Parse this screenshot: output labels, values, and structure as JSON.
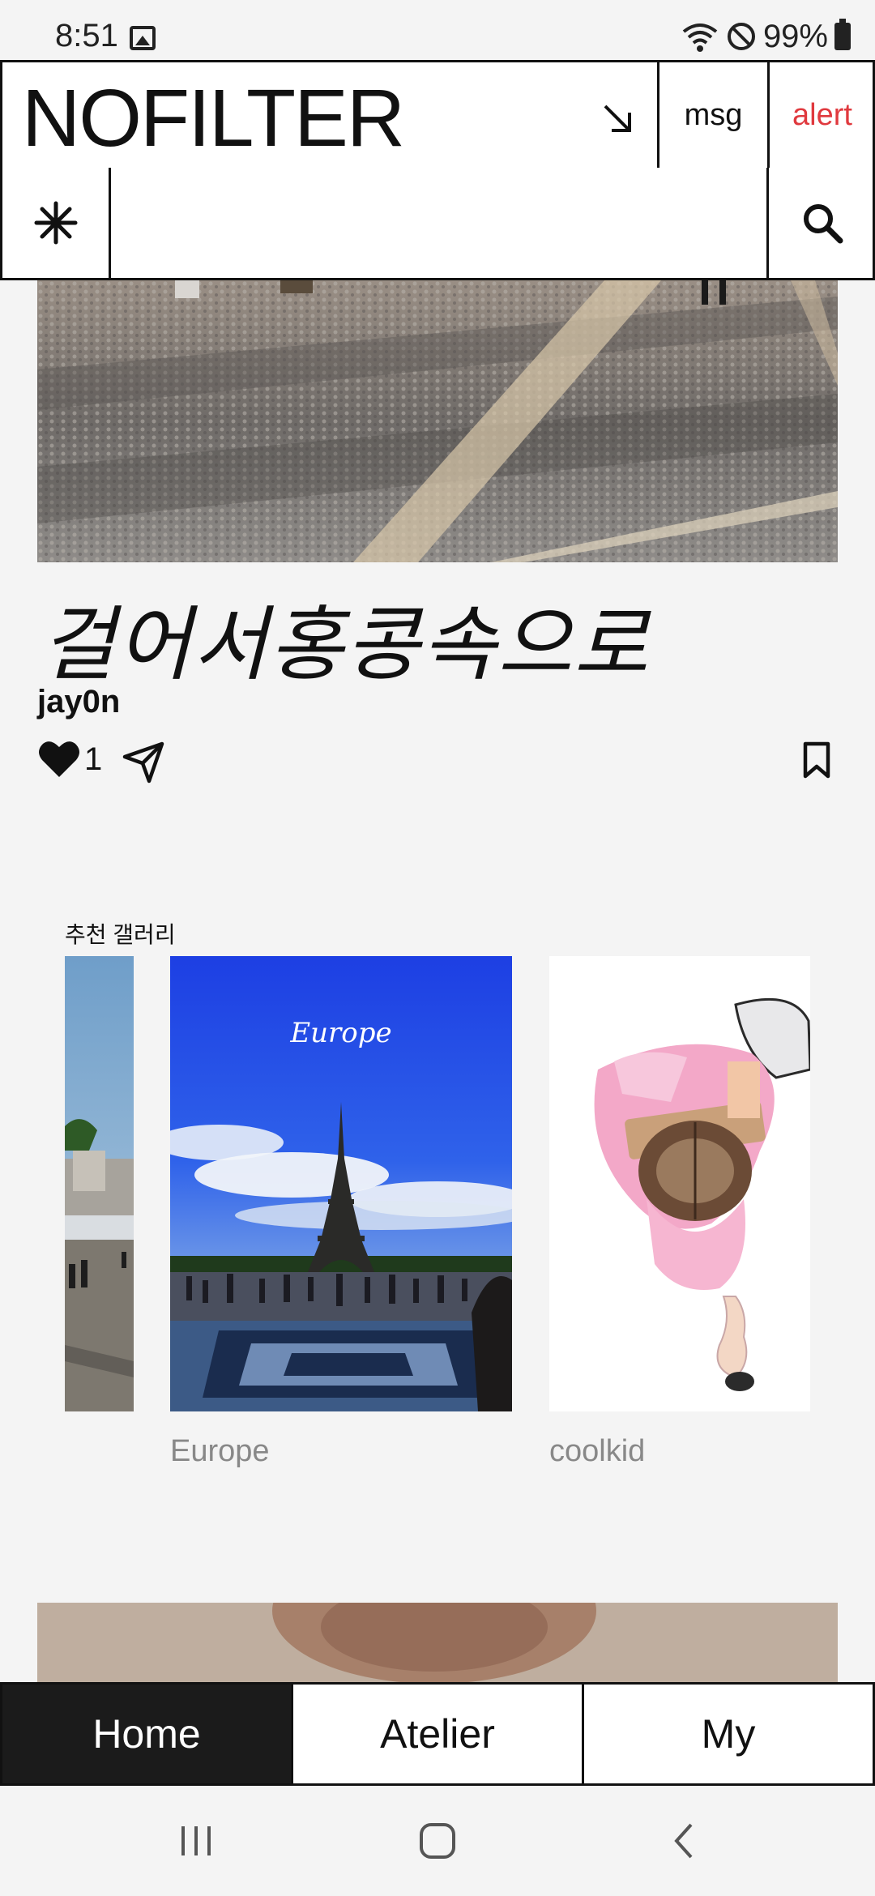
{
  "status_bar": {
    "time": "8:51",
    "battery_text": "99%"
  },
  "header": {
    "logo": "NOFILTER",
    "msg_label": "msg",
    "alert_label": "alert",
    "alert_color": "#e0393e"
  },
  "search": {
    "placeholder": ""
  },
  "post": {
    "title": "걸어서홍콩속으로",
    "author": "jay0n",
    "like_count": "1"
  },
  "gallery": {
    "title": "추천 갤러리",
    "cards": [
      {
        "label": ""
      },
      {
        "label": "Europe",
        "overlay_text": "Europe"
      },
      {
        "label": "coolkid"
      }
    ]
  },
  "bottom_nav": {
    "items": [
      {
        "label": "Home",
        "active": true
      },
      {
        "label": "Atelier",
        "active": false
      },
      {
        "label": "My",
        "active": false
      }
    ]
  },
  "icons": {
    "header_arrow": "arrow-down-right-icon",
    "star": "asterisk-icon",
    "search": "search-icon",
    "like": "heart-icon",
    "share": "paper-plane-icon",
    "bookmark": "bookmark-icon"
  }
}
